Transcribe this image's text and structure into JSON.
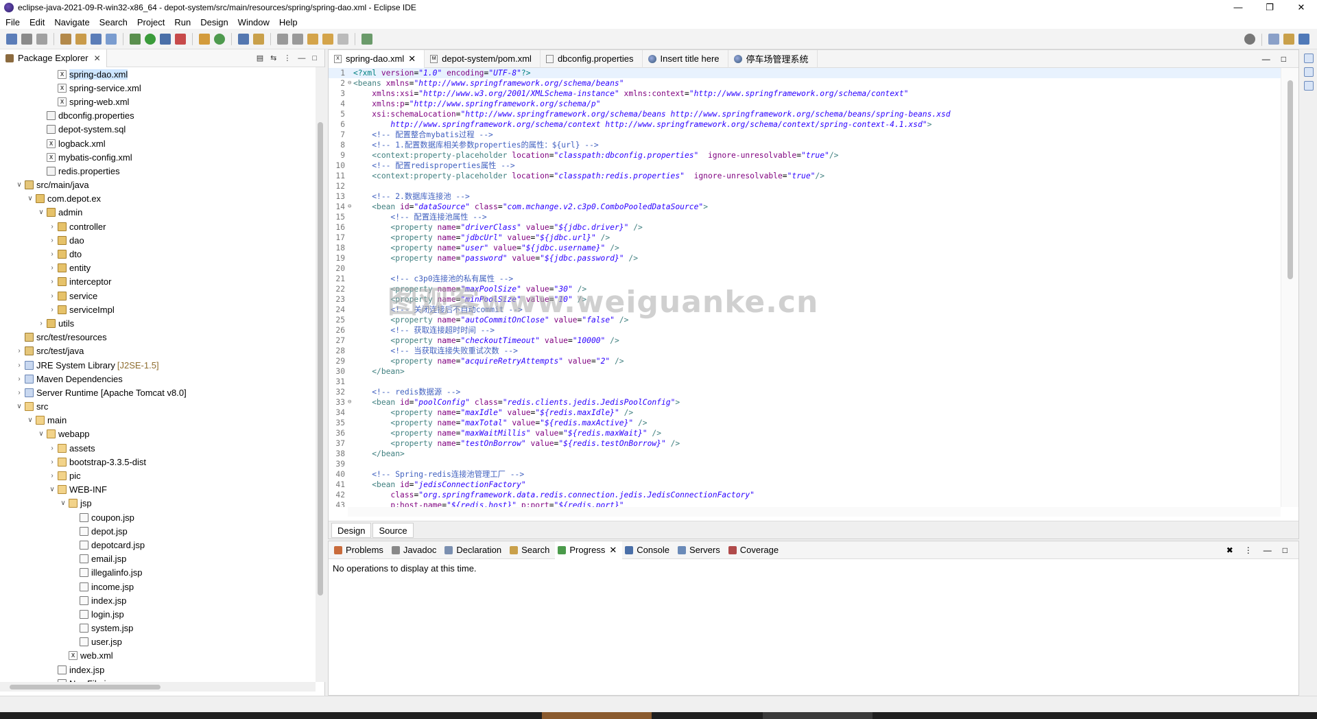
{
  "window": {
    "title": "eclipse-java-2021-09-R-win32-x86_64 - depot-system/src/main/resources/spring/spring-dao.xml - Eclipse IDE",
    "controls": [
      "—",
      "❐",
      "✕"
    ]
  },
  "menu": [
    "File",
    "Edit",
    "Navigate",
    "Search",
    "Project",
    "Run",
    "Design",
    "Window",
    "Help"
  ],
  "package_explorer": {
    "title": "Package Explorer",
    "close": "✕",
    "rows": [
      {
        "indent": 4,
        "toggle": "",
        "icon": "X",
        "kind": "xml",
        "label": "spring-dao.xml",
        "sel": true
      },
      {
        "indent": 4,
        "toggle": "",
        "icon": "X",
        "kind": "xml",
        "label": "spring-service.xml"
      },
      {
        "indent": 4,
        "toggle": "",
        "icon": "X",
        "kind": "xml",
        "label": "spring-web.xml"
      },
      {
        "indent": 3,
        "toggle": "",
        "icon": "",
        "kind": "prop",
        "label": "dbconfig.properties"
      },
      {
        "indent": 3,
        "toggle": "",
        "icon": "",
        "kind": "prop",
        "label": "depot-system.sql"
      },
      {
        "indent": 3,
        "toggle": "",
        "icon": "X",
        "kind": "xml",
        "label": "logback.xml"
      },
      {
        "indent": 3,
        "toggle": "",
        "icon": "X",
        "kind": "xml",
        "label": "mybatis-config.xml"
      },
      {
        "indent": 3,
        "toggle": "",
        "icon": "",
        "kind": "prop",
        "label": "redis.properties"
      },
      {
        "indent": 1,
        "toggle": "∨",
        "icon": "",
        "kind": "src",
        "label": "src/main/java"
      },
      {
        "indent": 2,
        "toggle": "∨",
        "icon": "",
        "kind": "pkg",
        "label": "com.depot.ex"
      },
      {
        "indent": 3,
        "toggle": "∨",
        "icon": "",
        "kind": "pkg",
        "label": "admin"
      },
      {
        "indent": 4,
        "toggle": "›",
        "icon": "",
        "kind": "pkg",
        "label": "controller"
      },
      {
        "indent": 4,
        "toggle": "›",
        "icon": "",
        "kind": "pkg",
        "label": "dao"
      },
      {
        "indent": 4,
        "toggle": "›",
        "icon": "",
        "kind": "pkg",
        "label": "dto"
      },
      {
        "indent": 4,
        "toggle": "›",
        "icon": "",
        "kind": "pkg",
        "label": "entity"
      },
      {
        "indent": 4,
        "toggle": "›",
        "icon": "",
        "kind": "pkg",
        "label": "interceptor"
      },
      {
        "indent": 4,
        "toggle": "›",
        "icon": "",
        "kind": "pkg",
        "label": "service"
      },
      {
        "indent": 4,
        "toggle": "›",
        "icon": "",
        "kind": "pkg",
        "label": "serviceImpl"
      },
      {
        "indent": 3,
        "toggle": "›",
        "icon": "",
        "kind": "pkg",
        "label": "utils"
      },
      {
        "indent": 1,
        "toggle": "",
        "icon": "",
        "kind": "src",
        "label": "src/test/resources"
      },
      {
        "indent": 1,
        "toggle": "›",
        "icon": "",
        "kind": "src",
        "label": "src/test/java"
      },
      {
        "indent": 1,
        "toggle": "›",
        "icon": "",
        "kind": "lib",
        "label": "JRE System Library",
        "suffix": "[J2SE-1.5]"
      },
      {
        "indent": 1,
        "toggle": "›",
        "icon": "",
        "kind": "lib",
        "label": "Maven Dependencies"
      },
      {
        "indent": 1,
        "toggle": "›",
        "icon": "",
        "kind": "lib",
        "label": "Server Runtime [Apache Tomcat v8.0]"
      },
      {
        "indent": 1,
        "toggle": "∨",
        "icon": "",
        "kind": "folder",
        "label": "src"
      },
      {
        "indent": 2,
        "toggle": "∨",
        "icon": "",
        "kind": "folder",
        "label": "main"
      },
      {
        "indent": 3,
        "toggle": "∨",
        "icon": "",
        "kind": "folder",
        "label": "webapp"
      },
      {
        "indent": 4,
        "toggle": "›",
        "icon": "",
        "kind": "folder",
        "label": "assets"
      },
      {
        "indent": 4,
        "toggle": "›",
        "icon": "",
        "kind": "folder",
        "label": "bootstrap-3.3.5-dist"
      },
      {
        "indent": 4,
        "toggle": "›",
        "icon": "",
        "kind": "folder",
        "label": "pic"
      },
      {
        "indent": 4,
        "toggle": "∨",
        "icon": "",
        "kind": "folder",
        "label": "WEB-INF"
      },
      {
        "indent": 5,
        "toggle": "∨",
        "icon": "",
        "kind": "folder",
        "label": "jsp"
      },
      {
        "indent": 6,
        "toggle": "",
        "icon": "",
        "kind": "jsp",
        "label": "coupon.jsp"
      },
      {
        "indent": 6,
        "toggle": "",
        "icon": "",
        "kind": "jsp",
        "label": "depot.jsp"
      },
      {
        "indent": 6,
        "toggle": "",
        "icon": "",
        "kind": "jsp",
        "label": "depotcard.jsp"
      },
      {
        "indent": 6,
        "toggle": "",
        "icon": "",
        "kind": "jsp",
        "label": "email.jsp"
      },
      {
        "indent": 6,
        "toggle": "",
        "icon": "",
        "kind": "jsp",
        "label": "illegalinfo.jsp"
      },
      {
        "indent": 6,
        "toggle": "",
        "icon": "",
        "kind": "jsp",
        "label": "income.jsp"
      },
      {
        "indent": 6,
        "toggle": "",
        "icon": "",
        "kind": "jsp",
        "label": "index.jsp"
      },
      {
        "indent": 6,
        "toggle": "",
        "icon": "",
        "kind": "jsp",
        "label": "login.jsp"
      },
      {
        "indent": 6,
        "toggle": "",
        "icon": "",
        "kind": "jsp",
        "label": "system.jsp"
      },
      {
        "indent": 6,
        "toggle": "",
        "icon": "",
        "kind": "jsp",
        "label": "user.jsp"
      },
      {
        "indent": 5,
        "toggle": "",
        "icon": "X",
        "kind": "xml",
        "label": "web.xml"
      },
      {
        "indent": 4,
        "toggle": "",
        "icon": "",
        "kind": "jsp",
        "label": "index.jsp"
      },
      {
        "indent": 4,
        "toggle": "",
        "icon": "",
        "kind": "jsp",
        "label": "NewFile.jsp"
      }
    ]
  },
  "editor": {
    "tabs": [
      {
        "label": "spring-dao.xml",
        "icon": "X",
        "active": true,
        "close": "✕"
      },
      {
        "label": "depot-system/pom.xml",
        "icon": "M"
      },
      {
        "label": "dbconfig.properties",
        "icon": ""
      },
      {
        "label": "Insert title here",
        "icon": "globe"
      },
      {
        "label": "停车场管理系统",
        "icon": "globe"
      }
    ],
    "lines": [
      {
        "n": "1",
        "f": "",
        "h": "<span class=\"pi\">&lt;?xml</span> <span class=\"attr\">version</span>=<span class=\"val\">\"1.0\"</span> <span class=\"attr\">encoding</span>=<span class=\"val\">\"UTF-8\"</span><span class=\"pi\">?&gt;</span>",
        "cur": true
      },
      {
        "n": "2",
        "f": "⊖",
        "h": "<span class=\"tag\">&lt;beans</span> <span class=\"attr\">xmlns</span>=<span class=\"val\">\"http://www.springframework.org/schema/beans\"</span>"
      },
      {
        "n": "3",
        "f": "",
        "h": "    <span class=\"attr\">xmlns:xsi</span>=<span class=\"val\">\"http://www.w3.org/2001/XMLSchema-instance\"</span> <span class=\"attr\">xmlns:context</span>=<span class=\"val\">\"http://www.springframework.org/schema/context\"</span>"
      },
      {
        "n": "4",
        "f": "",
        "h": "    <span class=\"attr\">xmlns:p</span>=<span class=\"val\">\"http://www.springframework.org/schema/p\"</span>"
      },
      {
        "n": "5",
        "f": "",
        "h": "    <span class=\"attr\">xsi:schemaLocation</span>=<span class=\"val\">\"http://www.springframework.org/schema/beans http://www.springframework.org/schema/beans/spring-beans.xsd</span>"
      },
      {
        "n": "6",
        "f": "",
        "h": "        <span class=\"val\">http://www.springframework.org/schema/context http://www.springframework.org/schema/context/spring-context-4.1.xsd\"</span><span class=\"tag\">&gt;</span>"
      },
      {
        "n": "7",
        "f": "",
        "h": "    <span class=\"cm\">&lt;!-- 配置整合mybatis过程 --&gt;</span>"
      },
      {
        "n": "8",
        "f": "",
        "h": "    <span class=\"cm\">&lt;!-- 1.配置数据库相关参数properties的属性：${url} --&gt;</span>"
      },
      {
        "n": "9",
        "f": "",
        "h": "    <span class=\"tag\">&lt;context:property-placeholder</span> <span class=\"attr\">location</span>=<span class=\"val\">\"classpath:dbconfig.properties\"</span>  <span class=\"attr\">ignore-unresolvable</span>=<span class=\"val\">\"true\"</span><span class=\"tag\">/&gt;</span>"
      },
      {
        "n": "10",
        "f": "",
        "h": "    <span class=\"cm\">&lt;!-- 配置redisproperties属性 --&gt;</span>"
      },
      {
        "n": "11",
        "f": "",
        "h": "    <span class=\"tag\">&lt;context:property-placeholder</span> <span class=\"attr\">location</span>=<span class=\"val\">\"classpath:redis.properties\"</span>  <span class=\"attr\">ignore-unresolvable</span>=<span class=\"val\">\"true\"</span><span class=\"tag\">/&gt;</span>"
      },
      {
        "n": "12",
        "f": "",
        "h": ""
      },
      {
        "n": "13",
        "f": "",
        "h": "    <span class=\"cm\">&lt;!-- 2.数据库连接池 --&gt;</span>"
      },
      {
        "n": "14",
        "f": "⊖",
        "h": "    <span class=\"tag\">&lt;bean</span> <span class=\"attr\">id</span>=<span class=\"val\">\"dataSource\"</span> <span class=\"attr\">class</span>=<span class=\"val\">\"com.mchange.v2.c3p0.ComboPooledDataSource\"</span><span class=\"tag\">&gt;</span>"
      },
      {
        "n": "15",
        "f": "",
        "h": "        <span class=\"cm\">&lt;!-- 配置连接池属性 --&gt;</span>"
      },
      {
        "n": "16",
        "f": "",
        "h": "        <span class=\"tag\">&lt;property</span> <span class=\"attr\">name</span>=<span class=\"val\">\"driverClass\"</span> <span class=\"attr\">value</span>=<span class=\"val\">\"${jdbc.driver}\"</span> <span class=\"tag\">/&gt;</span>"
      },
      {
        "n": "17",
        "f": "",
        "h": "        <span class=\"tag\">&lt;property</span> <span class=\"attr\">name</span>=<span class=\"val\">\"jdbcUrl\"</span> <span class=\"attr\">value</span>=<span class=\"val\">\"${jdbc.url}\"</span> <span class=\"tag\">/&gt;</span>"
      },
      {
        "n": "18",
        "f": "",
        "h": "        <span class=\"tag\">&lt;property</span> <span class=\"attr\">name</span>=<span class=\"val\">\"user\"</span> <span class=\"attr\">value</span>=<span class=\"val\">\"${jdbc.username}\"</span> <span class=\"tag\">/&gt;</span>"
      },
      {
        "n": "19",
        "f": "",
        "h": "        <span class=\"tag\">&lt;property</span> <span class=\"attr\">name</span>=<span class=\"val\">\"password\"</span> <span class=\"attr\">value</span>=<span class=\"val\">\"${jdbc.password}\"</span> <span class=\"tag\">/&gt;</span>"
      },
      {
        "n": "20",
        "f": "",
        "h": ""
      },
      {
        "n": "21",
        "f": "",
        "h": "        <span class=\"cm\">&lt;!-- c3p0连接池的私有属性 --&gt;</span>"
      },
      {
        "n": "22",
        "f": "",
        "h": "        <span class=\"tag\">&lt;property</span> <span class=\"attr\">name</span>=<span class=\"val\">\"maxPoolSize\"</span> <span class=\"attr\">value</span>=<span class=\"val\">\"30\"</span> <span class=\"tag\">/&gt;</span>"
      },
      {
        "n": "23",
        "f": "",
        "h": "        <span class=\"tag\">&lt;property</span> <span class=\"attr\">name</span>=<span class=\"val\">\"minPoolSize\"</span> <span class=\"attr\">value</span>=<span class=\"val\">\"10\"</span> <span class=\"tag\">/&gt;</span>"
      },
      {
        "n": "24",
        "f": "",
        "h": "        <span class=\"cm\">&lt;!-- 关闭连接后不自动commit --&gt;</span>"
      },
      {
        "n": "25",
        "f": "",
        "h": "        <span class=\"tag\">&lt;property</span> <span class=\"attr\">name</span>=<span class=\"val\">\"autoCommitOnClose\"</span> <span class=\"attr\">value</span>=<span class=\"val\">\"false\"</span> <span class=\"tag\">/&gt;</span>"
      },
      {
        "n": "26",
        "f": "",
        "h": "        <span class=\"cm\">&lt;!-- 获取连接超时时间 --&gt;</span>"
      },
      {
        "n": "27",
        "f": "",
        "h": "        <span class=\"tag\">&lt;property</span> <span class=\"attr\">name</span>=<span class=\"val\">\"checkoutTimeout\"</span> <span class=\"attr\">value</span>=<span class=\"val\">\"10000\"</span> <span class=\"tag\">/&gt;</span>"
      },
      {
        "n": "28",
        "f": "",
        "h": "        <span class=\"cm\">&lt;!-- 当获取连接失败重试次数 --&gt;</span>"
      },
      {
        "n": "29",
        "f": "",
        "h": "        <span class=\"tag\">&lt;property</span> <span class=\"attr\">name</span>=<span class=\"val\">\"acquireRetryAttempts\"</span> <span class=\"attr\">value</span>=<span class=\"val\">\"2\"</span> <span class=\"tag\">/&gt;</span>"
      },
      {
        "n": "30",
        "f": "",
        "h": "    <span class=\"tag\">&lt;/bean&gt;</span>"
      },
      {
        "n": "31",
        "f": "",
        "h": ""
      },
      {
        "n": "32",
        "f": "",
        "h": "    <span class=\"cm\">&lt;!-- redis数据源 --&gt;</span>"
      },
      {
        "n": "33",
        "f": "⊖",
        "h": "    <span class=\"tag\">&lt;bean</span> <span class=\"attr\">id</span>=<span class=\"val\">\"poolConfig\"</span> <span class=\"attr\">class</span>=<span class=\"val\">\"redis.clients.jedis.JedisPoolConfig\"</span><span class=\"tag\">&gt;</span>"
      },
      {
        "n": "34",
        "f": "",
        "h": "        <span class=\"tag\">&lt;property</span> <span class=\"attr\">name</span>=<span class=\"val\">\"maxIdle\"</span> <span class=\"attr\">value</span>=<span class=\"val\">\"${redis.maxIdle}\"</span> <span class=\"tag\">/&gt;</span>"
      },
      {
        "n": "35",
        "f": "",
        "h": "        <span class=\"tag\">&lt;property</span> <span class=\"attr\">name</span>=<span class=\"val\">\"maxTotal\"</span> <span class=\"attr\">value</span>=<span class=\"val\">\"${redis.maxActive}\"</span> <span class=\"tag\">/&gt;</span>"
      },
      {
        "n": "36",
        "f": "",
        "h": "        <span class=\"tag\">&lt;property</span> <span class=\"attr\">name</span>=<span class=\"val\">\"maxWaitMillis\"</span> <span class=\"attr\">value</span>=<span class=\"val\">\"${redis.maxWait}\"</span> <span class=\"tag\">/&gt;</span>"
      },
      {
        "n": "37",
        "f": "",
        "h": "        <span class=\"tag\">&lt;property</span> <span class=\"attr\">name</span>=<span class=\"val\">\"testOnBorrow\"</span> <span class=\"attr\">value</span>=<span class=\"val\">\"${redis.testOnBorrow}\"</span> <span class=\"tag\">/&gt;</span>"
      },
      {
        "n": "38",
        "f": "",
        "h": "    <span class=\"tag\">&lt;/bean&gt;</span>"
      },
      {
        "n": "39",
        "f": "",
        "h": ""
      },
      {
        "n": "40",
        "f": "",
        "h": "    <span class=\"cm\">&lt;!-- Spring-redis连接池管理工厂 --&gt;</span>"
      },
      {
        "n": "41",
        "f": "",
        "h": "    <span class=\"tag\">&lt;bean</span> <span class=\"attr\">id</span>=<span class=\"val\">\"jedisConnectionFactory\"</span>"
      },
      {
        "n": "42",
        "f": "",
        "h": "        <span class=\"attr\">class</span>=<span class=\"val\">\"org.springframework.data.redis.connection.jedis.JedisConnectionFactory\"</span>"
      },
      {
        "n": "43",
        "f": "",
        "h": "        <span class=\"attr\">p:host-name</span>=<span class=\"val\">\"${redis.host}\"</span> <span class=\"attr\">p:port</span>=<span class=\"val\">\"${redis.port}\"</span>"
      }
    ],
    "bottom_tabs": [
      "Design",
      "Source"
    ],
    "watermark": "图观客www.weiguanke.cn"
  },
  "bottom_panel": {
    "tabs": [
      "Problems",
      "Javadoc",
      "Declaration",
      "Search",
      "Progress",
      "Console",
      "Servers",
      "Coverage"
    ],
    "active": "Progress",
    "message": "No operations to display at this time."
  }
}
